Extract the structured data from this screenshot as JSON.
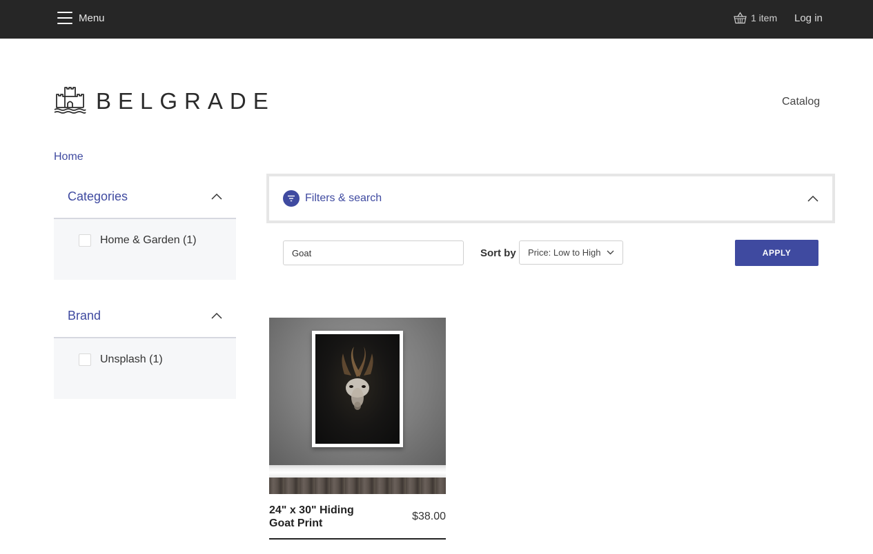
{
  "topbar": {
    "menu_label": "Menu",
    "cart_label": "1 item",
    "login_label": "Log in",
    "background_color": "#262626"
  },
  "header": {
    "brand_name": "BELGRADE",
    "logo_icon": "castle-icon",
    "nav_catalog": "Catalog"
  },
  "breadcrumb": {
    "home": "Home"
  },
  "sidebar": {
    "facets": [
      {
        "title": "Categories",
        "expanded": true,
        "options": [
          {
            "label": "Home & Garden (1)",
            "checked": false
          }
        ]
      },
      {
        "title": "Brand",
        "expanded": true,
        "options": [
          {
            "label": "Unsplash (1)",
            "checked": false
          }
        ]
      }
    ]
  },
  "filters": {
    "panel_label": "Filters & search",
    "search_value": "Goat",
    "sort_label": "Sort by",
    "sort_selected": "Price: Low to High",
    "apply_label": "APPLY"
  },
  "products": [
    {
      "name": "24\" x 30\" Hiding Goat Print",
      "price": "$38.00"
    }
  ],
  "colors": {
    "accent": "#3f4aa0",
    "sidebar_bg": "#f6f7f9",
    "text": "#333333"
  }
}
